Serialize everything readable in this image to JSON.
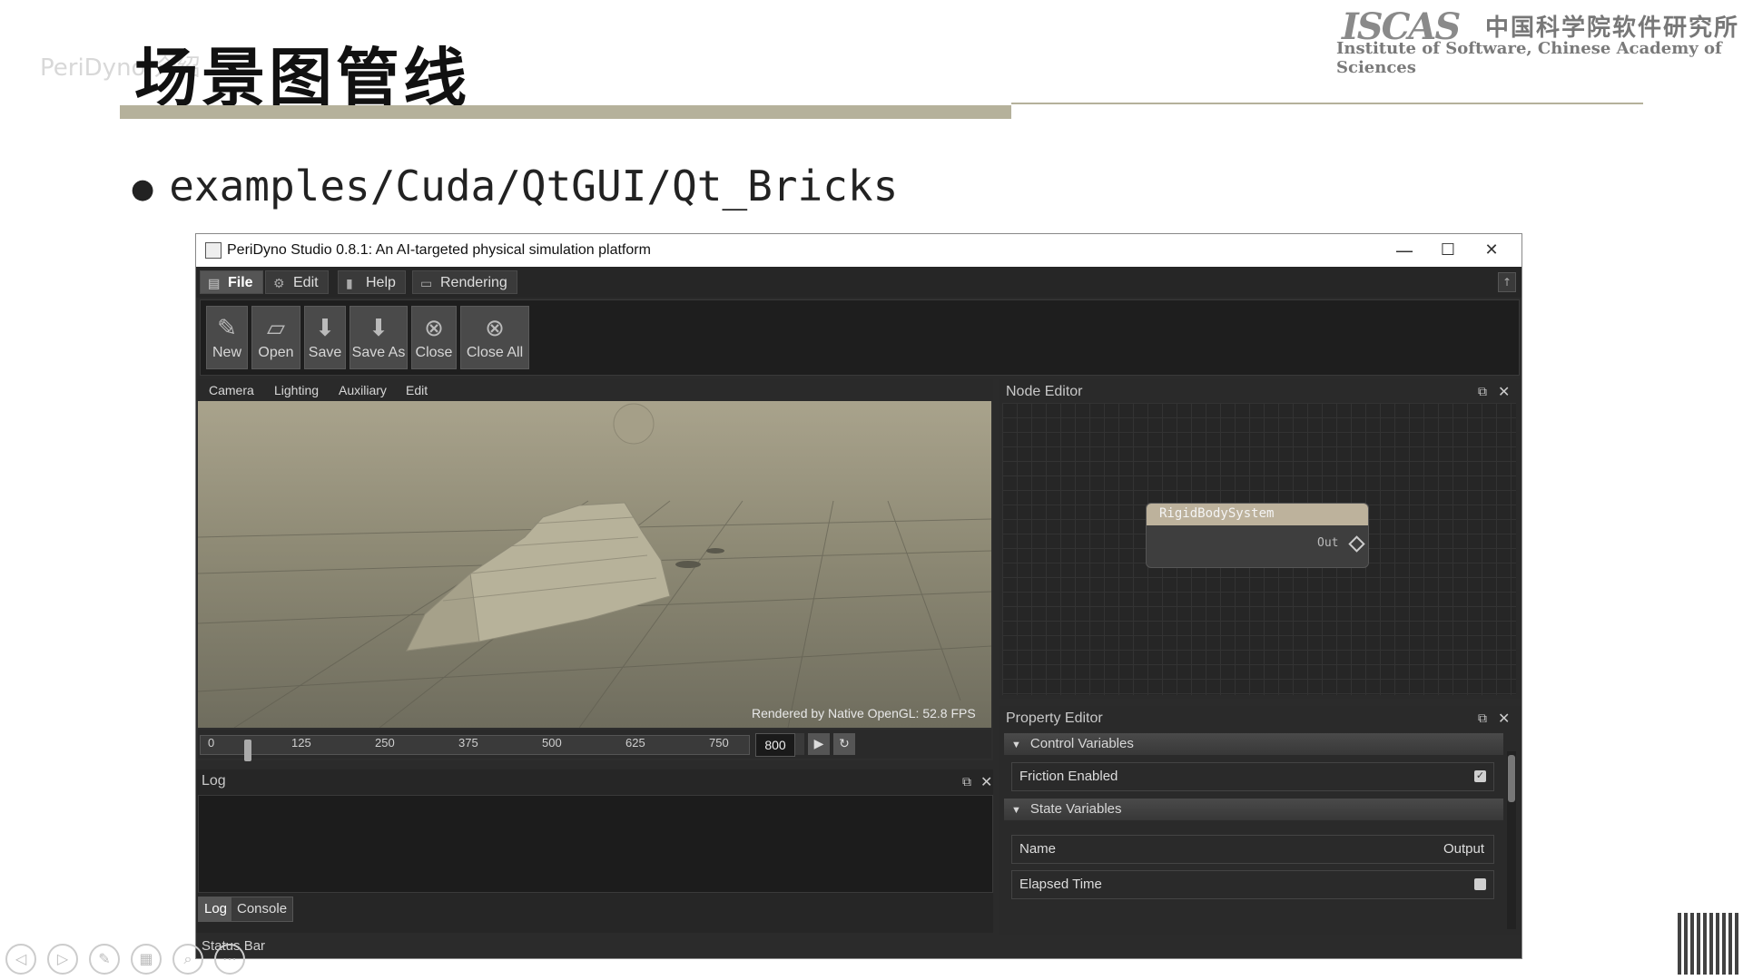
{
  "slide": {
    "title": "场景图管线",
    "ghost_text": "PeriDyno 介绍",
    "logo_mark": "ISCAS",
    "logo_cn": "中国科学院软件研究所",
    "logo_en": "Institute of Software, Chinese Academy of Sciences",
    "bullet": "examples/Cuda/QtGUI/Qt_Bricks",
    "colors": {
      "accent_bar": "#b5b19b"
    }
  },
  "window": {
    "title": "PeriDyno Studio 0.8.1:  An AI-targeted physical simulation platform",
    "controls": {
      "minimize": "—",
      "maximize": "☐",
      "close": "✕"
    }
  },
  "menu": {
    "items": [
      {
        "label": "File",
        "icon": "file-icon"
      },
      {
        "label": "Edit",
        "icon": "gear-icon"
      },
      {
        "label": "Help",
        "icon": "book-icon"
      },
      {
        "label": "Rendering",
        "icon": "monitor-icon"
      }
    ]
  },
  "toolbar": {
    "buttons": [
      {
        "label": "New",
        "icon": "new-file-icon"
      },
      {
        "label": "Open",
        "icon": "folder-open-icon"
      },
      {
        "label": "Save",
        "icon": "save-icon"
      },
      {
        "label": "Save As",
        "icon": "save-as-icon"
      },
      {
        "label": "Close",
        "icon": "close-file-icon"
      },
      {
        "label": "Close All",
        "icon": "close-all-icon"
      }
    ]
  },
  "viewport": {
    "menus": [
      "Camera",
      "Lighting",
      "Auxiliary",
      "Edit"
    ],
    "fps_text": "Rendered by Native OpenGL: 52.8 FPS",
    "timeline": {
      "ticks": [
        "0",
        "125",
        "250",
        "375",
        "500",
        "625",
        "750"
      ],
      "frame_value": "800",
      "current_fraction": 0.08
    }
  },
  "log": {
    "title": "Log",
    "tabs": [
      "Log",
      "Console"
    ]
  },
  "status_bar": {
    "text": "Status Bar"
  },
  "node_editor": {
    "title": "Node Editor",
    "node": {
      "title": "RigidBodySystem",
      "output": "Out"
    }
  },
  "property_editor": {
    "title": "Property Editor",
    "groups": [
      {
        "label": "Control Variables"
      },
      {
        "label": "State Variables"
      }
    ],
    "rows": {
      "friction": {
        "label": "Friction Enabled",
        "checked": true
      },
      "name": {
        "label": "Name",
        "value": "Output"
      },
      "elapsed": {
        "label": "Elapsed Time"
      }
    }
  }
}
